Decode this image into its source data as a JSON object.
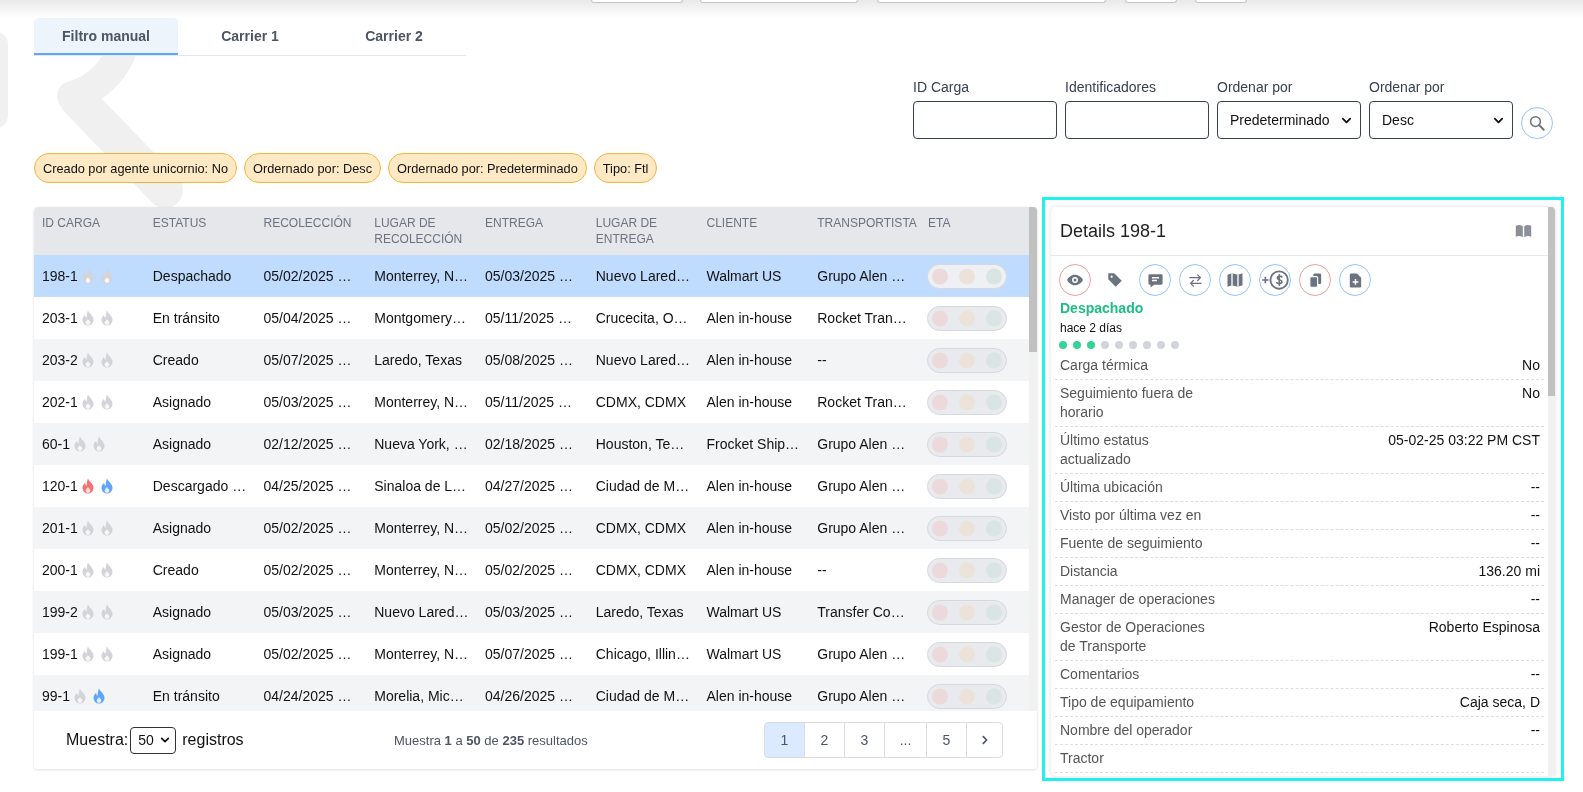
{
  "tabs": [
    {
      "label": "Filtro manual",
      "selected": true
    },
    {
      "label": "Carrier 1",
      "selected": false
    },
    {
      "label": "Carrier 2",
      "selected": false
    }
  ],
  "filters": [
    {
      "kind": "input",
      "label": "ID Carga"
    },
    {
      "kind": "input",
      "label": "Identificadores"
    },
    {
      "kind": "select",
      "label": "Ordenar por",
      "value": "Predeterminado"
    },
    {
      "kind": "select",
      "label": "Ordenar por",
      "value": "Desc"
    }
  ],
  "chips": [
    "Creado por agente unicornio: No",
    "Ordernado por: Desc",
    "Ordernado por: Predeterminado",
    "Tipo: Ftl"
  ],
  "table": {
    "columns": [
      "ID CARGA",
      "ESTATUS",
      "RECOLECCIÓN",
      "LUGAR DE RECOLECCIÓN",
      "ENTREGA",
      "LUGAR DE ENTREGA",
      "CLIENTE",
      "TRANSPORTISTA",
      "ETA"
    ],
    "rows": [
      {
        "cells": [
          "198-1",
          "Despachado",
          "05/02/2025 …",
          "Monterrey, N…",
          "05/03/2025 …",
          "Nuevo Lared…",
          "Walmart US",
          "Grupo Alen …"
        ],
        "flames": [
          {
            "on": false
          },
          {
            "on": false
          }
        ],
        "selected": true
      },
      {
        "cells": [
          "203-1",
          "En tránsito",
          "05/04/2025 …",
          "Montgomery…",
          "05/11/2025 …",
          "Crucecita, O…",
          "Alen in-house",
          "Rocket Tran…"
        ],
        "flames": [
          {
            "on": false
          },
          {
            "on": false
          }
        ],
        "selected": false
      },
      {
        "cells": [
          "203-2",
          "Creado",
          "05/07/2025 …",
          "Laredo, Texas",
          "05/08/2025 …",
          "Nuevo Lared…",
          "Alen in-house",
          "--"
        ],
        "flames": [
          {
            "on": false
          },
          {
            "on": false
          }
        ],
        "selected": false
      },
      {
        "cells": [
          "202-1",
          "Asignado",
          "05/03/2025 …",
          "Monterrey, N…",
          "05/11/2025 …",
          "CDMX, CDMX",
          "Alen in-house",
          "Rocket Tran…"
        ],
        "flames": [
          {
            "on": false
          },
          {
            "on": false
          }
        ],
        "selected": false
      },
      {
        "cells": [
          "60-1",
          "Asignado",
          "02/12/2025 …",
          "Nueva York, …",
          "02/18/2025 …",
          "Houston, Te…",
          "Frocket Ship…",
          "Grupo Alen …"
        ],
        "flames": [
          {
            "on": false
          },
          {
            "on": false
          }
        ],
        "selected": false
      },
      {
        "cells": [
          "120-1",
          "Descargado …",
          "04/25/2025 …",
          "Sinaloa de L…",
          "04/27/2025 …",
          "Ciudad de M…",
          "Alen in-house",
          "Grupo Alen …"
        ],
        "flames": [
          {
            "on": true
          },
          {
            "on": true
          }
        ],
        "selected": false
      },
      {
        "cells": [
          "201-1",
          "Asignado",
          "05/02/2025 …",
          "Monterrey, N…",
          "05/02/2025 …",
          "CDMX, CDMX",
          "Alen in-house",
          "Grupo Alen …"
        ],
        "flames": [
          {
            "on": false
          },
          {
            "on": false
          }
        ],
        "selected": false
      },
      {
        "cells": [
          "200-1",
          "Creado",
          "05/02/2025 …",
          "Monterrey, N…",
          "05/02/2025 …",
          "CDMX, CDMX",
          "Alen in-house",
          "--"
        ],
        "flames": [
          {
            "on": false
          },
          {
            "on": false
          }
        ],
        "selected": false
      },
      {
        "cells": [
          "199-2",
          "Asignado",
          "05/03/2025 …",
          "Nuevo Lared…",
          "05/03/2025 …",
          "Laredo, Texas",
          "Walmart US",
          "Transfer Co…"
        ],
        "flames": [
          {
            "on": false
          },
          {
            "on": false
          }
        ],
        "selected": false
      },
      {
        "cells": [
          "199-1",
          "Asignado",
          "05/02/2025 …",
          "Monterrey, N…",
          "05/07/2025 …",
          "Chicago, Illin…",
          "Walmart US",
          "Grupo Alen …"
        ],
        "flames": [
          {
            "on": false
          },
          {
            "on": false
          }
        ],
        "selected": false
      },
      {
        "cells": [
          "99-1",
          "En tránsito",
          "04/24/2025 …",
          "Morelia, Mic…",
          "04/26/2025 …",
          "Ciudad de M…",
          "Alen in-house",
          "Grupo Alen …"
        ],
        "flames": [
          {
            "on": false
          },
          {
            "on": true
          }
        ],
        "selected": false
      }
    ]
  },
  "pagination": {
    "show_label": "Muestra:",
    "page_size": "50",
    "records_label": "registros",
    "summary": "Muestra **1** a **50** de **235** resultados",
    "pages": [
      {
        "label": "1",
        "selected": true
      },
      {
        "label": "2",
        "selected": false
      },
      {
        "label": "3",
        "selected": false
      },
      {
        "label": "...",
        "selected": false
      },
      {
        "label": "5",
        "selected": false
      }
    ]
  },
  "details": {
    "focused": true,
    "title": "Details 198-1",
    "actions": [
      {
        "kind": "eye",
        "color": "#e8a0a0"
      },
      {
        "kind": "tag"
      },
      {
        "kind": "message",
        "color": "#93c5fd"
      },
      {
        "kind": "swap",
        "color": "#93c5fd"
      },
      {
        "kind": "map",
        "color": "#93c5fd"
      },
      {
        "kind": "charge",
        "color": "#93c5fd"
      },
      {
        "kind": "copy",
        "color": "#e8a0a0"
      },
      {
        "kind": "document",
        "color": "#93c5fd"
      }
    ],
    "status": "Despachado",
    "time": "hace 2 días",
    "steps": [
      {
        "done": true
      },
      {
        "done": true
      },
      {
        "done": true
      },
      {
        "done": false
      },
      {
        "done": false
      },
      {
        "done": false
      },
      {
        "done": false
      },
      {
        "done": false
      },
      {
        "done": false
      }
    ],
    "fields": [
      {
        "label": "Carga térmica",
        "value": "No"
      },
      {
        "label": "Seguimiento fuera de horario",
        "value": "No"
      },
      {
        "label": "Último estatus actualizado",
        "value": "05-02-25 03:22 PM CST"
      },
      {
        "label": "Última ubicación",
        "value": "--"
      },
      {
        "label": "Visto por última vez en",
        "value": "--"
      },
      {
        "label": "Fuente de seguimiento",
        "value": "--"
      },
      {
        "label": "Distancia",
        "value": "136.20 mi"
      },
      {
        "label": "Manager de operaciones",
        "value": "--"
      },
      {
        "label": "Gestor de Operaciones de Transporte",
        "value": "Roberto Espinosa"
      },
      {
        "label": "Comentarios",
        "value": "--"
      },
      {
        "label": "Tipo de equipamiento",
        "value": "Caja seca, D"
      },
      {
        "label": "Nombre del operador",
        "value": "--"
      },
      {
        "label": "Tractor"
      }
    ]
  }
}
